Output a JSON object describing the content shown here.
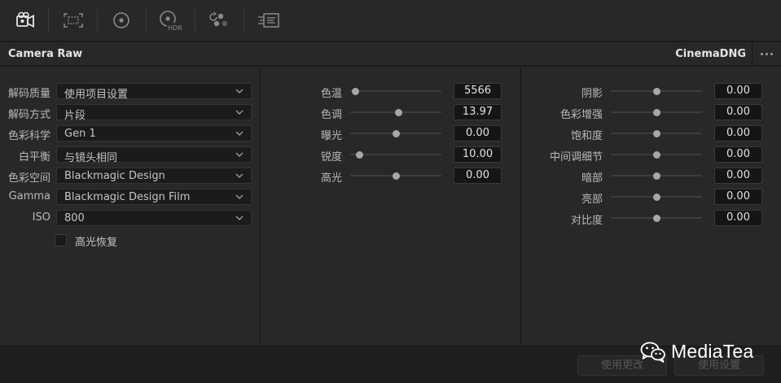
{
  "toolbar": {
    "icons": [
      "camera-raw-icon",
      "sizing-icon",
      "color-wheel-icon",
      "hdr-icon",
      "rgb-mixer-icon",
      "motion-effects-icon"
    ],
    "hdr_badge": "HDR"
  },
  "header": {
    "title": "Camera Raw",
    "format": "CinemaDNG"
  },
  "decode": {
    "rows": [
      {
        "label": "解码质量",
        "value": "使用项目设置"
      },
      {
        "label": "解码方式",
        "value": "片段"
      },
      {
        "label": "色彩科学",
        "value": "Gen 1"
      },
      {
        "label": "白平衡",
        "value": "与镜头相同"
      },
      {
        "label": "色彩空间",
        "value": "Blackmagic Design"
      },
      {
        "label": "Gamma",
        "value": "Blackmagic Design Film"
      },
      {
        "label": "ISO",
        "value": "800"
      }
    ],
    "highlight_recovery": {
      "label": "高光恢复",
      "checked": false
    }
  },
  "sliders_mid": [
    {
      "label": "色温",
      "value": "5566",
      "position": 0.06
    },
    {
      "label": "色调",
      "value": "13.97",
      "position": 0.53
    },
    {
      "label": "曝光",
      "value": "0.00",
      "position": 0.5
    },
    {
      "label": "锐度",
      "value": "10.00",
      "position": 0.1
    },
    {
      "label": "高光",
      "value": "0.00",
      "position": 0.5
    }
  ],
  "sliders_right": [
    {
      "label": "阴影",
      "value": "0.00",
      "position": 0.5
    },
    {
      "label": "色彩增强",
      "value": "0.00",
      "position": 0.5
    },
    {
      "label": "饱和度",
      "value": "0.00",
      "position": 0.5
    },
    {
      "label": "中间调细节",
      "value": "0.00",
      "position": 0.5
    },
    {
      "label": "暗部",
      "value": "0.00",
      "position": 0.5
    },
    {
      "label": "亮部",
      "value": "0.00",
      "position": 0.5
    },
    {
      "label": "对比度",
      "value": "0.00",
      "position": 0.5
    }
  ],
  "footer": {
    "use_changes": "使用更改",
    "use_settings": "使用设置"
  },
  "watermark": {
    "text": "MediaTea"
  }
}
